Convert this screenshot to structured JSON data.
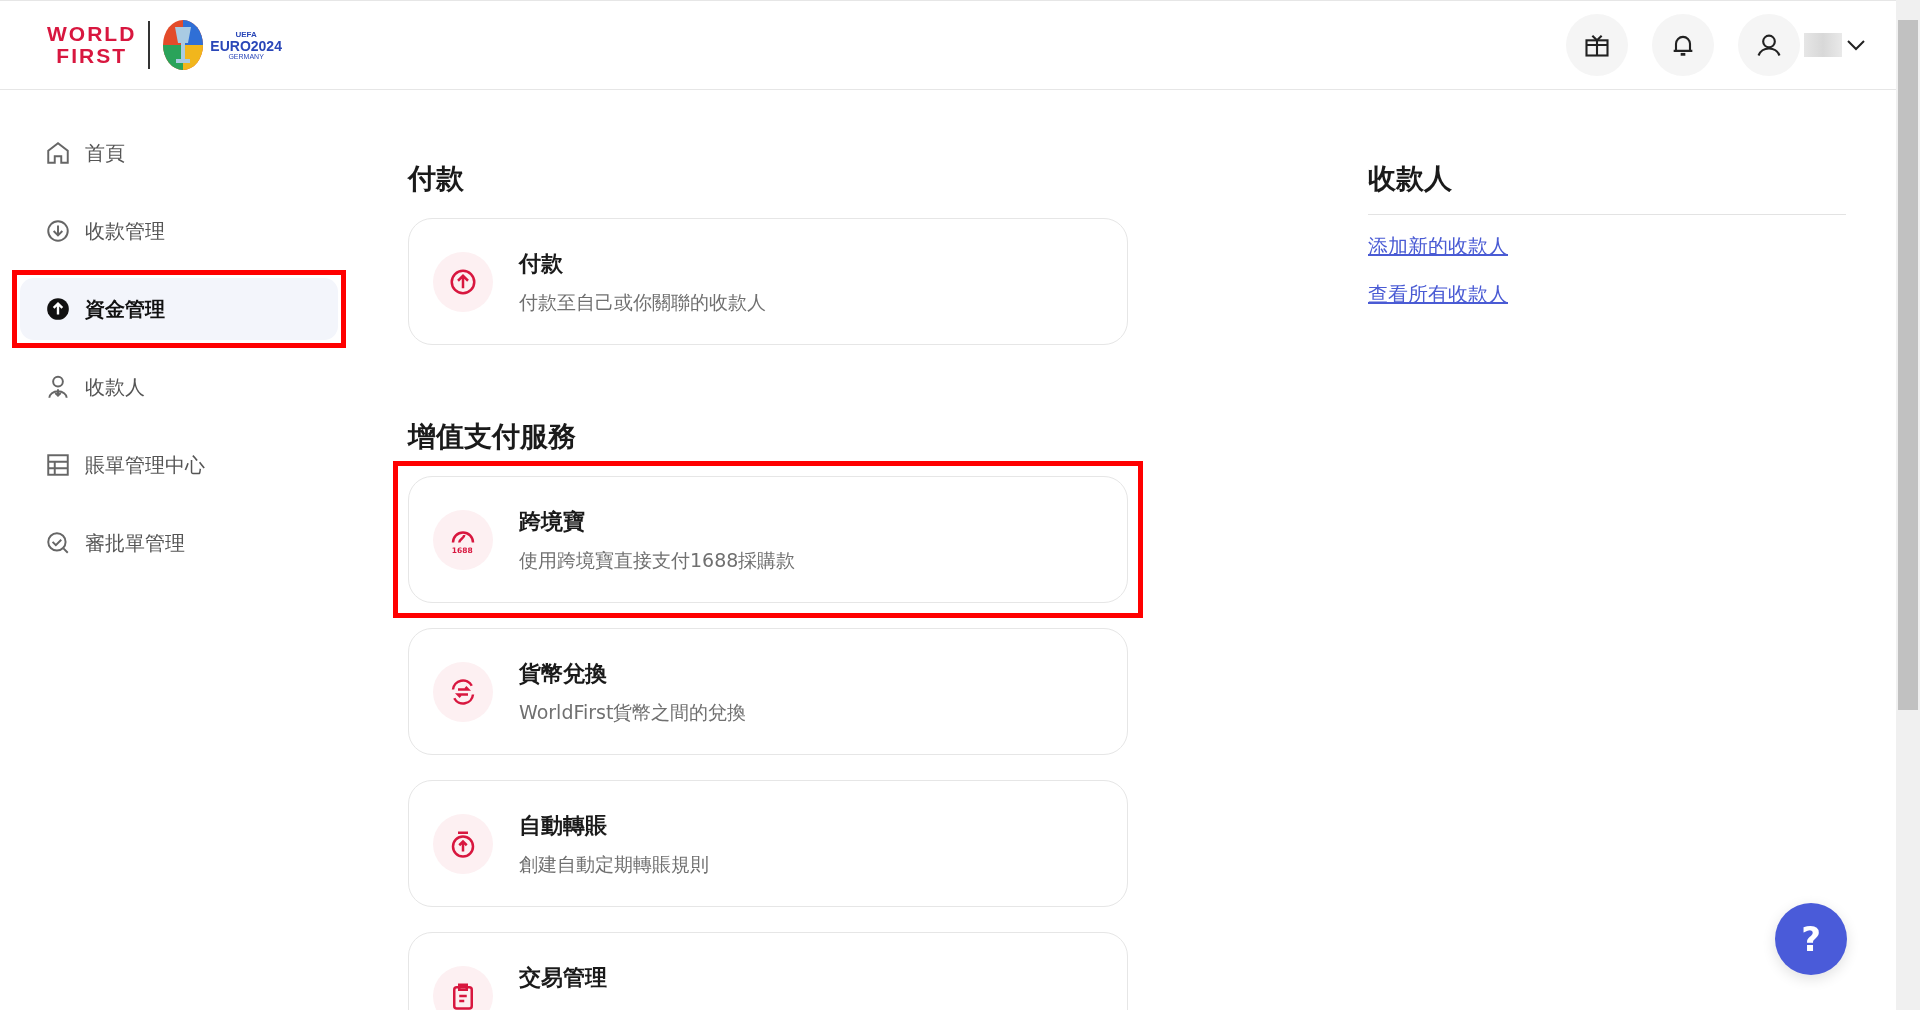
{
  "header": {
    "brand": [
      "WORLD",
      "FIRST"
    ],
    "partner_logo": {
      "top": "UEFA",
      "main": "EURO2024",
      "sub": "GERMANY"
    }
  },
  "sidebar": {
    "items": [
      {
        "kind": "home",
        "label": "首頁",
        "selected": false,
        "annotated": false
      },
      {
        "kind": "receive",
        "label": "收款管理",
        "selected": false,
        "annotated": false
      },
      {
        "kind": "send",
        "label": "資金管理",
        "selected": true,
        "annotated": true
      },
      {
        "kind": "payee",
        "label": "收款人",
        "selected": false,
        "annotated": false
      },
      {
        "kind": "table",
        "label": "賬單管理中心",
        "selected": false,
        "annotated": false
      },
      {
        "kind": "review",
        "label": "審批單管理",
        "selected": false,
        "annotated": false
      }
    ]
  },
  "sections": [
    {
      "title": "付款",
      "cards": [
        {
          "kind": "upload",
          "title": "付款",
          "description": "付款至自己或你關聯的收款人",
          "annotated": false
        }
      ]
    },
    {
      "title": "增值支付服務",
      "cards": [
        {
          "kind": "badge1688",
          "title": "跨境寶",
          "description": "使用跨境寶直接支付1688採購款",
          "badge": "1688",
          "annotated": true
        },
        {
          "kind": "exchange",
          "title": "貨幣兌換",
          "description": "WorldFirst貨幣之間的兌換",
          "annotated": false
        },
        {
          "kind": "timer",
          "title": "自動轉賬",
          "description": "創建自動定期轉賬規則",
          "annotated": false
        },
        {
          "kind": "clipboard",
          "title": "交易管理",
          "annotated": false
        }
      ]
    }
  ],
  "payees_panel": {
    "title": "收款人",
    "links": [
      "添加新的收款人",
      "查看所有收款人"
    ]
  },
  "help_button": {
    "label": "?"
  }
}
